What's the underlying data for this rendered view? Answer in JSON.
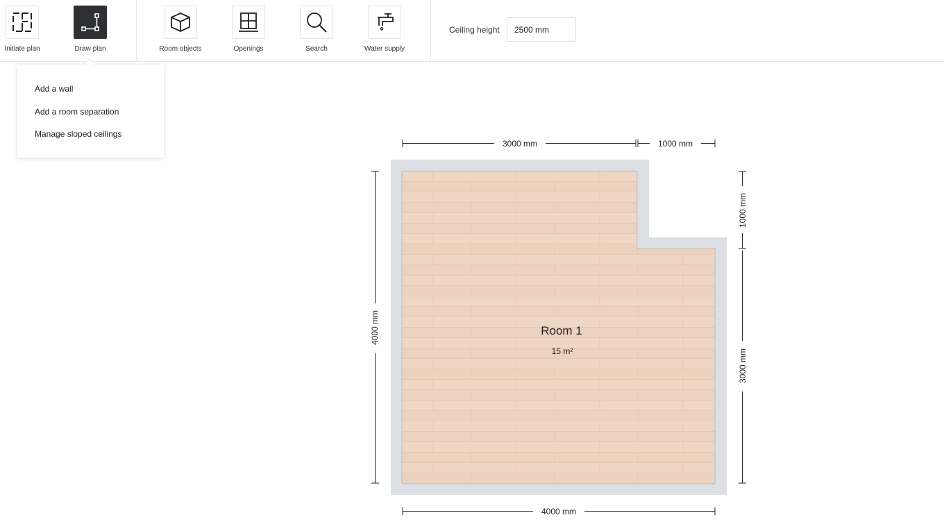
{
  "toolbar": {
    "tools": [
      {
        "label": "Initiate plan",
        "icon": "initiate-plan-icon"
      },
      {
        "label": "Draw plan",
        "icon": "draw-plan-icon",
        "active": true
      },
      {
        "label": "Room objects",
        "icon": "cube-icon"
      },
      {
        "label": "Openings",
        "icon": "window-icon"
      },
      {
        "label": "Search",
        "icon": "search-icon"
      },
      {
        "label": "Water supply",
        "icon": "faucet-icon"
      }
    ],
    "ceiling": {
      "label": "Ceiling height",
      "value": "2500 mm"
    }
  },
  "dropdown": {
    "items": [
      "Add a wall",
      "Add a room separation",
      "Manage sloped ceilings"
    ]
  },
  "plan": {
    "room": {
      "name": "Room 1",
      "area": "15 m²"
    },
    "dimensions": {
      "top_left": "3000 mm",
      "top_right": "1000 mm",
      "left": "4000 mm",
      "right_top": "1000 mm",
      "right_bottom": "3000 mm",
      "bottom": "4000 mm"
    }
  },
  "colors": {
    "wall": "#dcdfe3",
    "floor": "#ecd2bf",
    "active_tool": "#2f3033",
    "border": "#e4e6ea"
  }
}
